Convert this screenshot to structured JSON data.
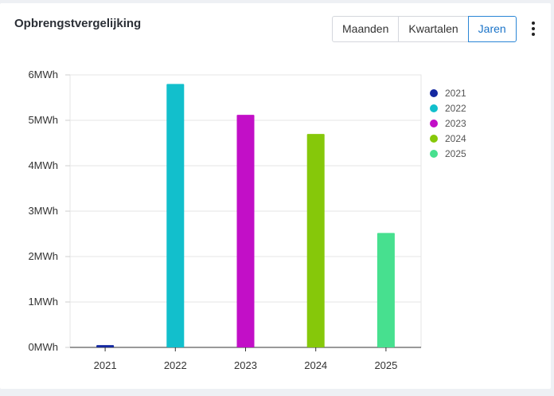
{
  "card": {
    "title": "Opbrengstvergelijking"
  },
  "toolbar": {
    "buttons": [
      {
        "label": "Maanden",
        "active": false
      },
      {
        "label": "Kwartalen",
        "active": false
      },
      {
        "label": "Jaren",
        "active": true
      }
    ],
    "menu_icon": "more-vertical-icon"
  },
  "chart_data": {
    "type": "bar",
    "categories": [
      "2021",
      "2022",
      "2023",
      "2024",
      "2025"
    ],
    "values": [
      0.05,
      5.8,
      5.12,
      4.7,
      2.52
    ],
    "colors": [
      "#1428a0",
      "#12bfcc",
      "#c20fc7",
      "#86c80a",
      "#47e08f"
    ],
    "ylim": [
      0,
      6
    ],
    "yticks": [
      "0MWh",
      "1MWh",
      "2MWh",
      "3MWh",
      "4MWh",
      "5MWh",
      "6MWh"
    ],
    "legend": [
      "2021",
      "2022",
      "2023",
      "2024",
      "2025"
    ],
    "legend_position": "right",
    "grid": true
  }
}
